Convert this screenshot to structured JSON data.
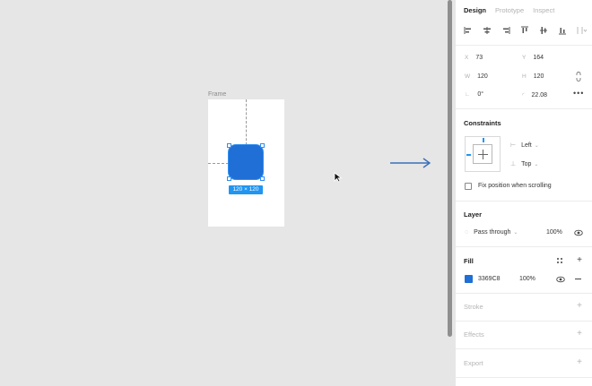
{
  "canvas": {
    "frame_label": "Frame",
    "size_badge": "120 × 120",
    "shape_color": "#1F6FD6",
    "accent_color": "#2095F2"
  },
  "panel": {
    "tabs": [
      {
        "label": "Design",
        "active": true
      },
      {
        "label": "Prototype",
        "active": false
      },
      {
        "label": "Inspect",
        "active": false
      }
    ],
    "align_icons": [
      "align-left-icon",
      "align-horizontal-center-icon",
      "align-right-icon",
      "align-top-icon",
      "align-vertical-center-icon",
      "align-bottom-icon",
      "distribute-icon"
    ],
    "position": {
      "x_label": "X",
      "x_value": "73",
      "y_label": "Y",
      "y_value": "164",
      "w_label": "W",
      "w_value": "120",
      "h_label": "H",
      "h_value": "120",
      "rotation_value": "0°",
      "radius_value": "22.08"
    },
    "constraints": {
      "title": "Constraints",
      "horizontal": "Left",
      "vertical": "Top",
      "fix_position_label": "Fix position when scrolling"
    },
    "layer": {
      "title": "Layer",
      "blend_mode": "Pass through",
      "opacity": "100%"
    },
    "fill": {
      "title": "Fill",
      "hex": "3369C8",
      "opacity": "100%",
      "color": "#1F6FD6"
    },
    "stroke": {
      "title": "Stroke"
    },
    "effects": {
      "title": "Effects"
    },
    "export": {
      "title": "Export"
    }
  }
}
